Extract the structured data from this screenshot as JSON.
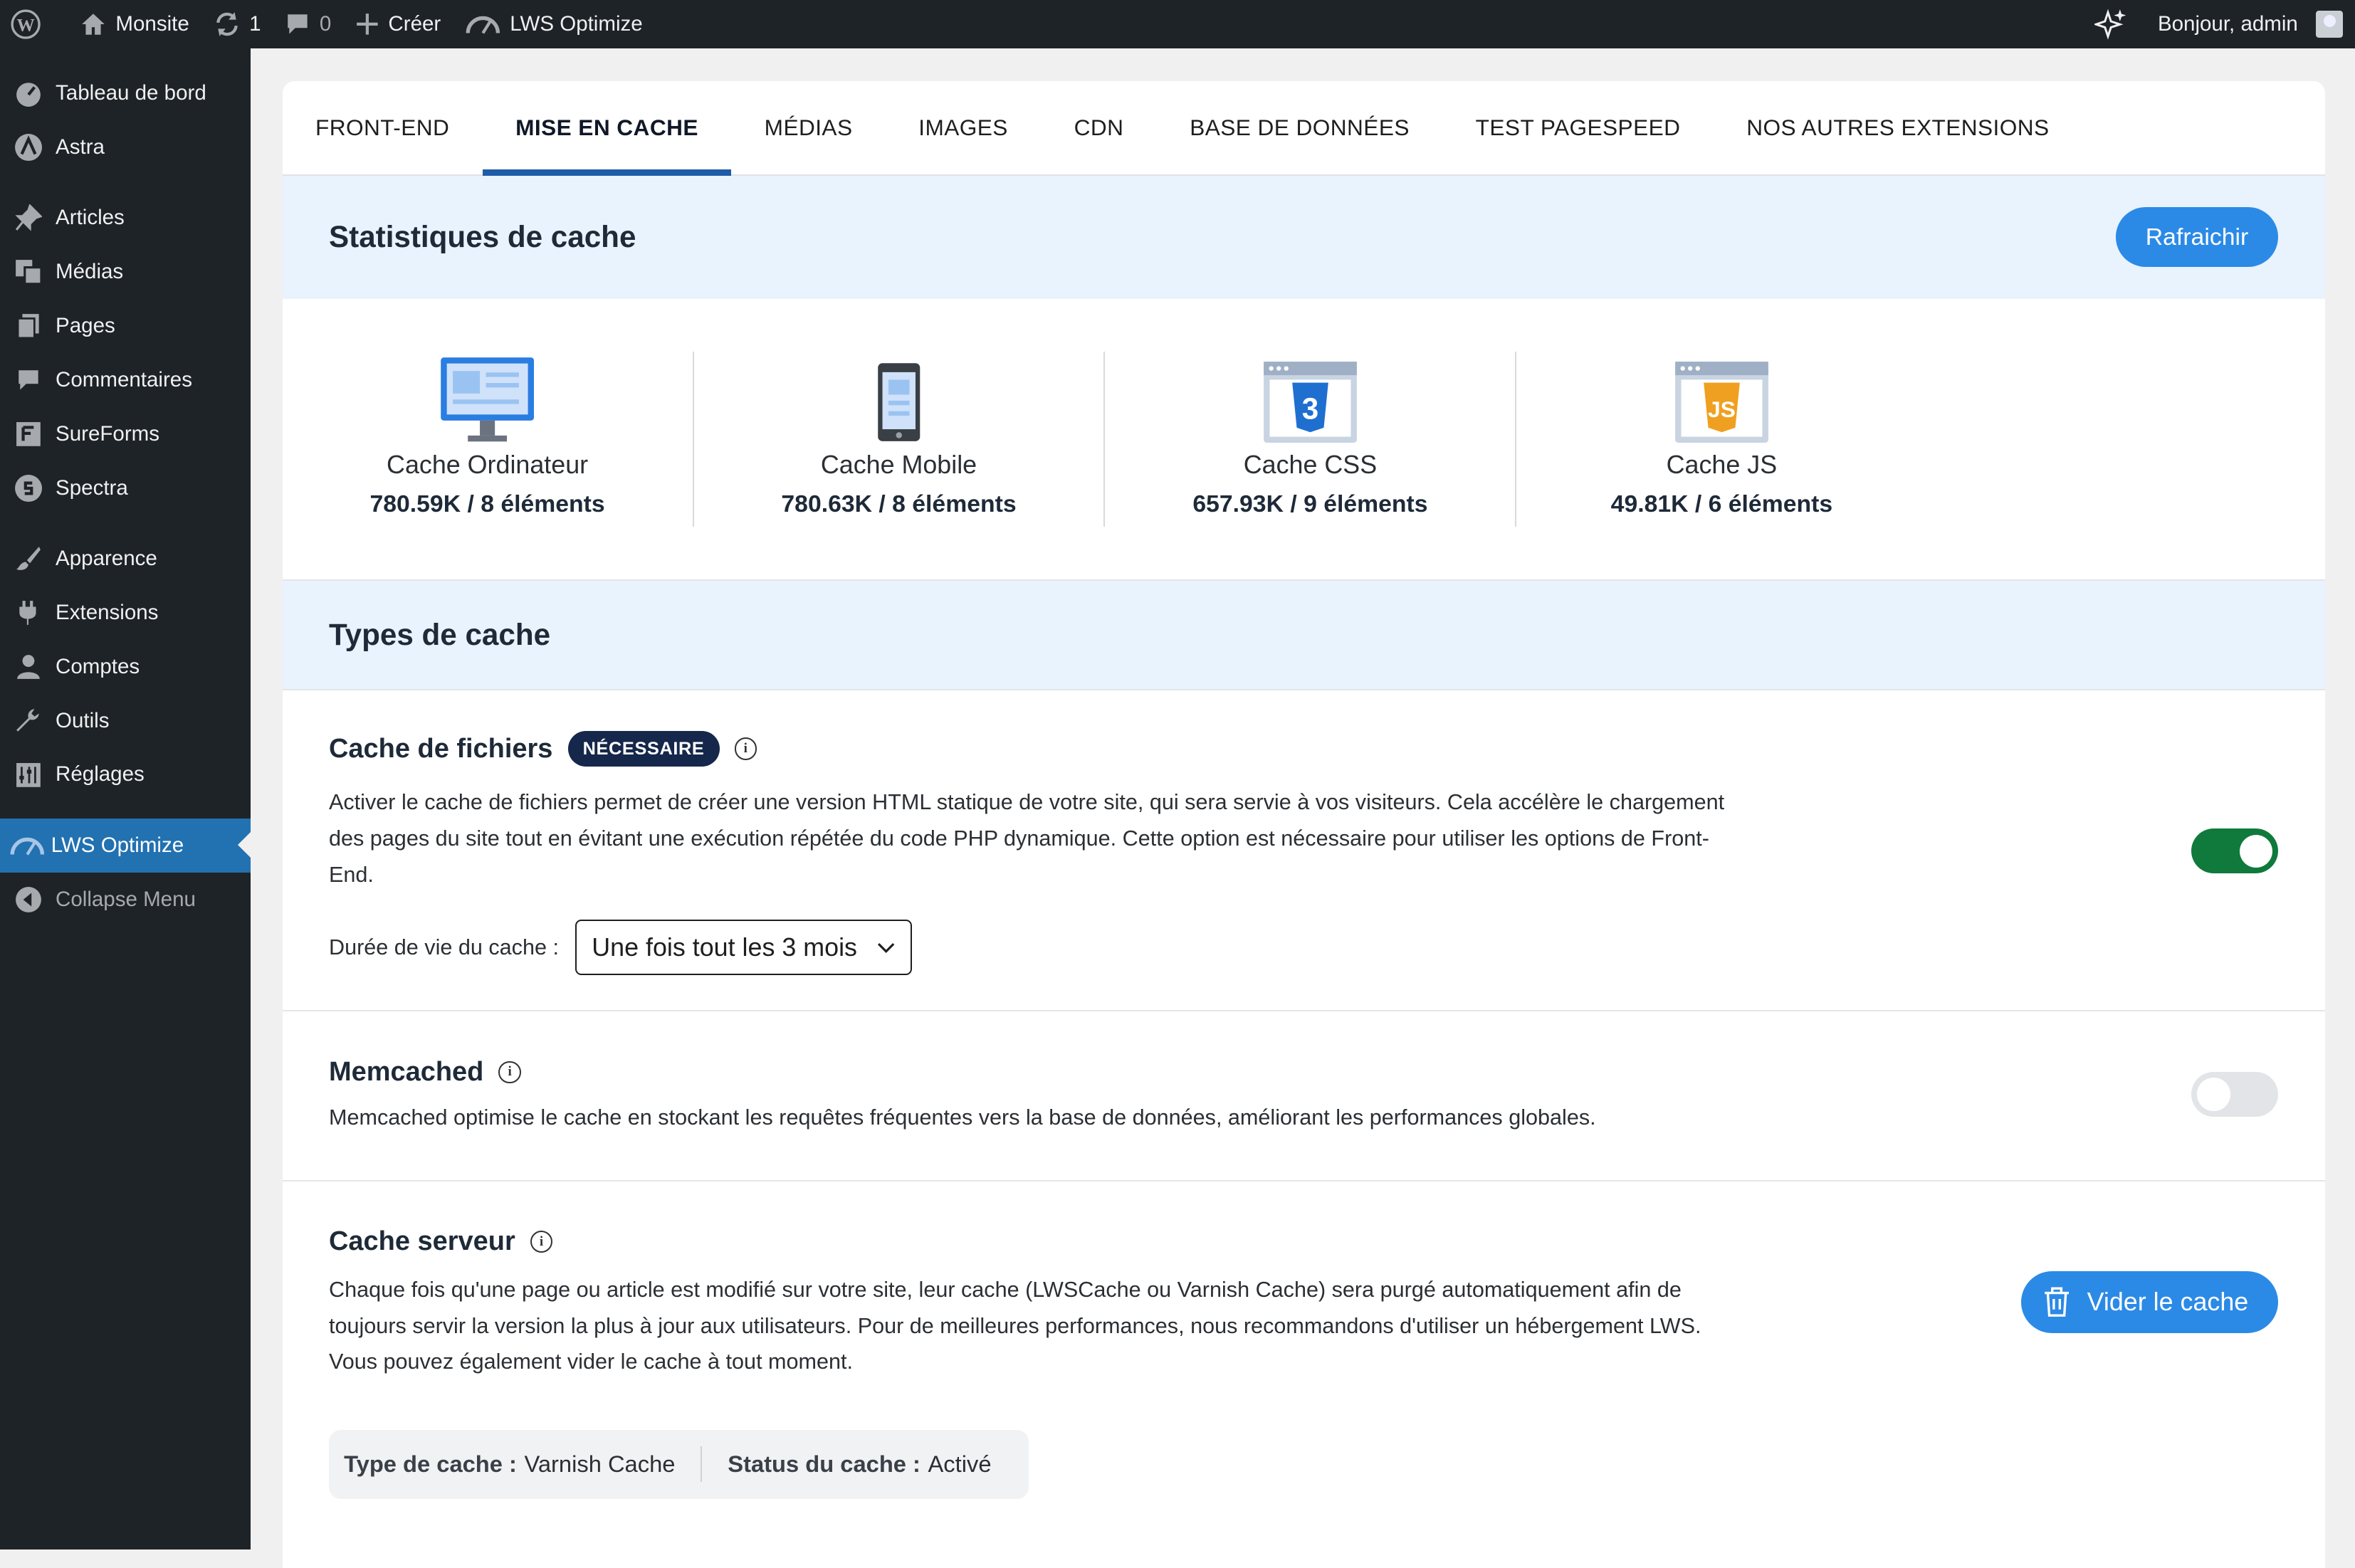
{
  "adminbar": {
    "site_name": "Monsite",
    "updates_count": "1",
    "comments_count": "0",
    "new_label": "Créer",
    "plugin_label": "LWS Optimize",
    "greeting": "Bonjour, admin"
  },
  "sidebar": {
    "items": [
      {
        "label": "Tableau de bord",
        "icon": "dashboard-icon"
      },
      {
        "label": "Astra",
        "icon": "astra-icon"
      },
      {
        "label": "Articles",
        "icon": "pin-icon"
      },
      {
        "label": "Médias",
        "icon": "media-icon"
      },
      {
        "label": "Pages",
        "icon": "pages-icon"
      },
      {
        "label": "Commentaires",
        "icon": "comment-icon"
      },
      {
        "label": "SureForms",
        "icon": "sureforms-icon"
      },
      {
        "label": "Spectra",
        "icon": "spectra-icon"
      },
      {
        "label": "Apparence",
        "icon": "brush-icon"
      },
      {
        "label": "Extensions",
        "icon": "plugin-icon"
      },
      {
        "label": "Comptes",
        "icon": "user-icon"
      },
      {
        "label": "Outils",
        "icon": "wrench-icon"
      },
      {
        "label": "Réglages",
        "icon": "settings-icon"
      },
      {
        "label": "LWS Optimize",
        "icon": "gauge-icon",
        "active": true
      },
      {
        "label": "Collapse Menu",
        "icon": "collapse-icon"
      }
    ]
  },
  "tabs": [
    "FRONT-END",
    "MISE EN CACHE",
    "MÉDIAS",
    "IMAGES",
    "CDN",
    "BASE DE DONNÉES",
    "TEST PAGESPEED",
    "NOS AUTRES EXTENSIONS"
  ],
  "active_tab": "MISE EN CACHE",
  "stats_section": {
    "title": "Statistiques de cache",
    "refresh_label": "Rafraichir",
    "items": [
      {
        "label": "Cache Ordinateur",
        "value": "780.59K / 8 éléments",
        "icon": "desktop-icon"
      },
      {
        "label": "Cache Mobile",
        "value": "780.63K / 8 éléments",
        "icon": "mobile-icon"
      },
      {
        "label": "Cache CSS",
        "value": "657.93K / 9 éléments",
        "icon": "css3-icon"
      },
      {
        "label": "Cache JS",
        "value": "49.81K / 6 éléments",
        "icon": "js-icon"
      }
    ]
  },
  "types_section": {
    "title": "Types de cache",
    "file_cache": {
      "title": "Cache de fichiers",
      "badge": "NÉCESSAIRE",
      "desc": "Activer le cache de fichiers permet de créer une version HTML statique de votre site, qui sera servie à vos visiteurs. Cela accélère le chargement des pages du site tout en évitant une exécution répétée du code PHP dynamique. Cette option est nécessaire pour utiliser les options de Front-End.",
      "enabled": true,
      "duration_label": "Durée de vie du cache :",
      "duration_value": "Une fois tout les 3 mois"
    },
    "memcached": {
      "title": "Memcached",
      "desc": "Memcached optimise le cache en stockant les requêtes fréquentes vers la base de données, améliorant les performances globales.",
      "enabled": false
    },
    "server_cache": {
      "title": "Cache serveur",
      "desc": "Chaque fois qu'une page ou article est modifié sur votre site, leur cache (LWSCache ou Varnish Cache) sera purgé automatiquement afin de toujours servir la version la plus à jour aux utilisateurs. Pour de meilleures performances, nous recommandons d'utiliser un hébergement LWS. Vous pouvez également vider le cache à tout moment.",
      "clear_label": "Vider le cache",
      "type_label": "Type de cache :",
      "type_value": "Varnish Cache",
      "status_label": "Status du cache :",
      "status_value": "Activé"
    }
  },
  "colors": {
    "accent_blue": "#2b8ae6",
    "tab_underline": "#1f5ca8",
    "toggle_on": "#0f7a3b",
    "section_bg": "#e8f3fd",
    "admin_bg": "#1d2327",
    "menu_active": "#2271b1"
  }
}
